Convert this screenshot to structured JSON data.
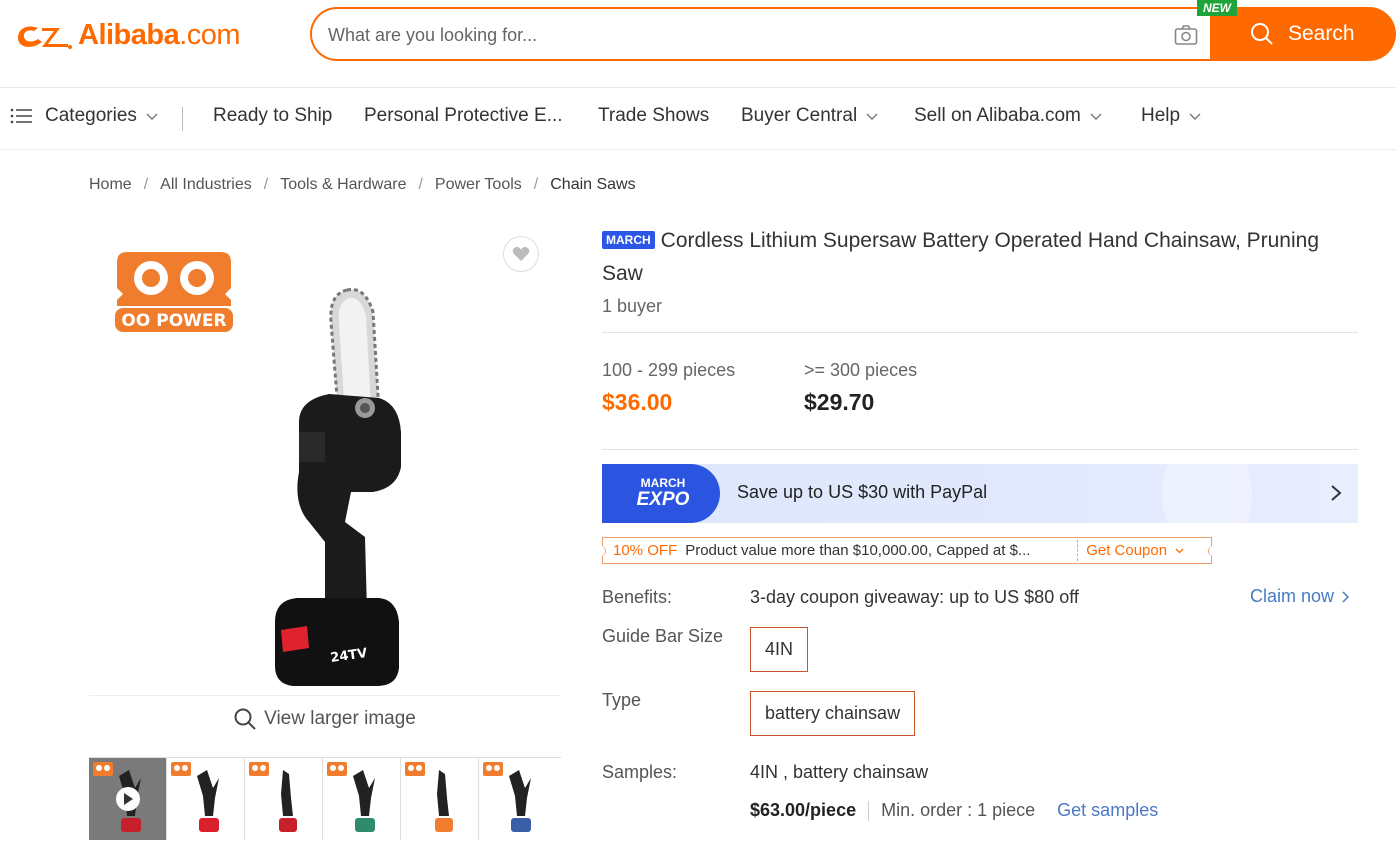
{
  "header": {
    "logo_brand": "Alibaba",
    "logo_domain": ".com",
    "search_placeholder": "What are you looking for...",
    "search_button": "Search",
    "new_tag": "NEW"
  },
  "nav": {
    "categories": "Categories",
    "items": [
      "Ready to Ship",
      "Personal Protective E...",
      "Trade Shows",
      "Buyer Central",
      "Sell on Alibaba.com",
      "Help"
    ]
  },
  "breadcrumb": [
    "Home",
    "All Industries",
    "Tools & Hardware",
    "Power Tools",
    "Chain Saws"
  ],
  "gallery": {
    "brand_logo_text": "OO POWER",
    "battery_text": "24TV",
    "view_larger": "View larger image",
    "thumbnail_count": 6
  },
  "product": {
    "badge": "MARCH",
    "title": "Cordless Lithium Supersaw Battery Operated Hand Chainsaw, Pruning Saw",
    "buyers": "1 buyer",
    "price_tiers": [
      {
        "qty": "100 - 299 pieces",
        "price": "$36.00"
      },
      {
        "qty": ">= 300 pieces",
        "price": "$29.70"
      }
    ],
    "expo": {
      "badge_top": "MARCH",
      "badge_bottom": "EXPO",
      "text": "Save up to US $30 with PayPal"
    },
    "coupon": {
      "off": "10% OFF",
      "desc": "Product value more than $10,000.00, Capped at $...",
      "get": "Get Coupon"
    },
    "benefits": {
      "label": "Benefits:",
      "value": "3-day coupon giveaway: up to US $80 off",
      "claim": "Claim now"
    },
    "guide_bar": {
      "label": "Guide Bar Size",
      "option": "4IN"
    },
    "type": {
      "label": "Type",
      "option": "battery chainsaw"
    },
    "samples": {
      "label": "Samples:",
      "value": "4IN , battery chainsaw",
      "price": "$63.00/piece",
      "min_order": "Min. order : 1 piece",
      "get": "Get samples"
    }
  },
  "colors": {
    "accent": "#ff6a00",
    "link": "#4a79c4",
    "expo_blue": "#2b55e0",
    "new_green": "#1ea43a"
  }
}
